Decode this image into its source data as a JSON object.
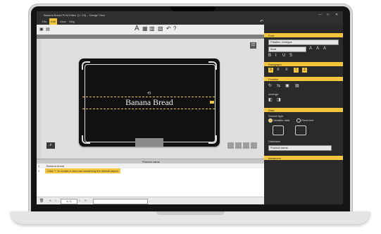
{
  "window": {
    "title": "Banana Bread Print Editor (1 / 24) – Design View",
    "controls": {
      "minimize": "—",
      "maximize": "□",
      "close": "✕"
    }
  },
  "menubar": {
    "items": [
      "File",
      "Edit",
      "View",
      "Help"
    ],
    "active_index": 1
  },
  "toolbar": {
    "text_tool": "A",
    "icons": [
      "image-icon",
      "barcode-icon",
      "shape-icon",
      "undo-icon",
      "help-icon"
    ]
  },
  "label": {
    "text": "Banana Bread"
  },
  "datagrid": {
    "header": "Product name",
    "rows": [
      {
        "num": "1",
        "value": "Banana bread"
      },
      {
        "num": "2",
        "value": "Click '+' to create a new row containing the default layout"
      }
    ]
  },
  "bottombar": {
    "page": "1 / 1",
    "prev": "‹",
    "next": "›",
    "first": "«",
    "last": "»"
  },
  "panel": {
    "sections": [
      "Font",
      "Paragraph",
      "Position",
      "Data",
      "Advanced"
    ],
    "font_family": "Palatino Linotype",
    "font_size": "Bold",
    "arrange_label": "Arrange",
    "source_type_label": "Source type",
    "source_options": [
      "Variable data",
      "Fixed text"
    ],
    "selected_source": 0,
    "database_label": "Database",
    "database_value": "Product name"
  },
  "colors": {
    "accent": "#f3c53b",
    "panel_bg": "#2a2a2a",
    "label_bg": "#111111"
  }
}
